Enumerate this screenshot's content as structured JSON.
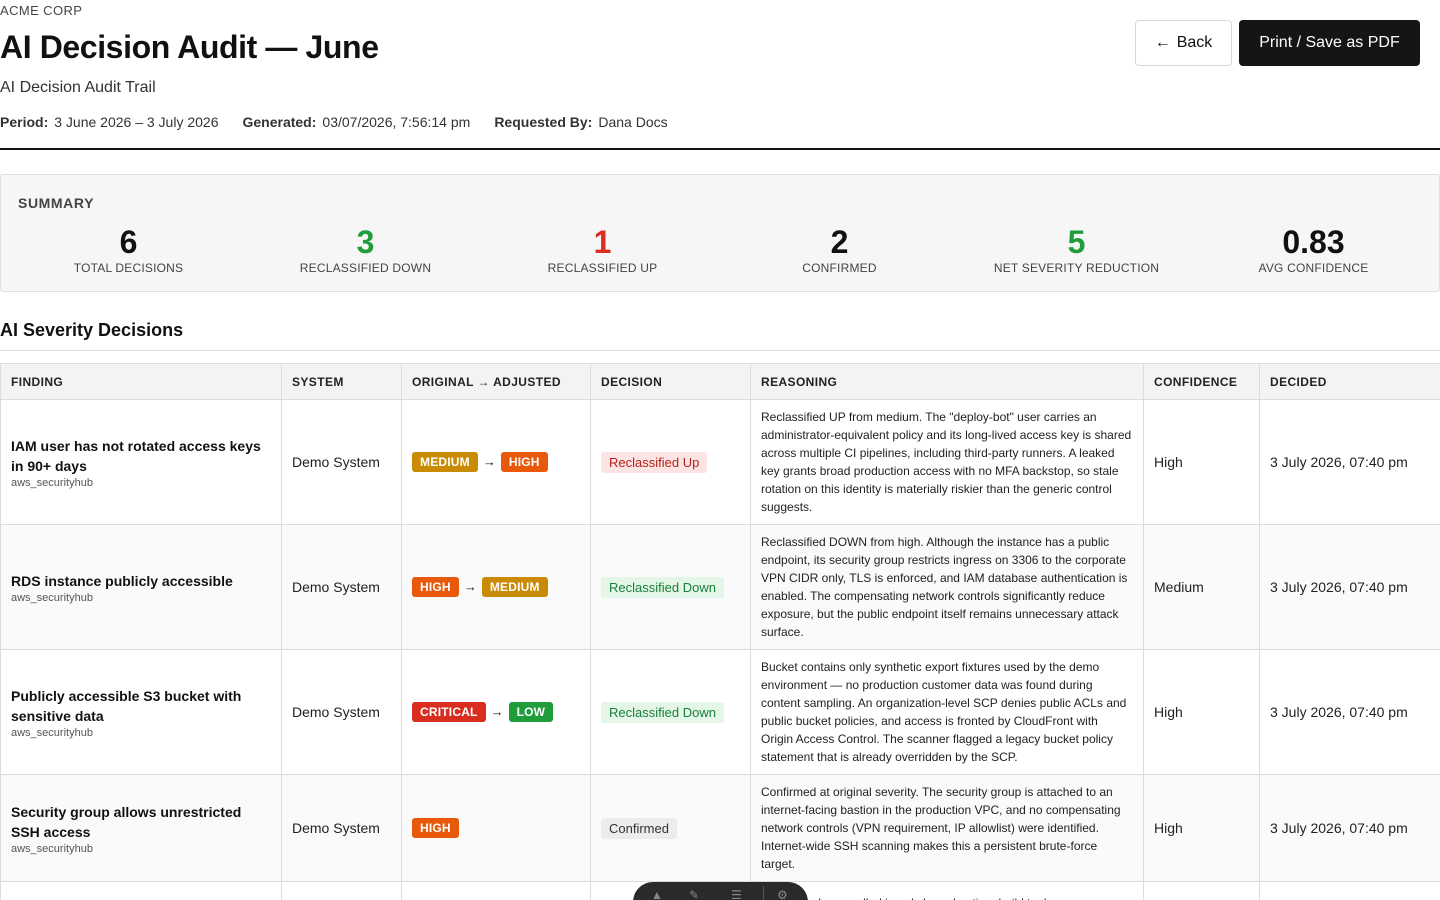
{
  "header": {
    "company": "ACME CORP",
    "title": "AI Decision Audit — June",
    "subtitle": "AI Decision Audit Trail",
    "meta": [
      {
        "key": "Period:",
        "value": "3 June 2026 – 3 July 2026"
      },
      {
        "key": "Generated:",
        "value": "03/07/2026, 7:56:14 pm"
      },
      {
        "key": "Requested By:",
        "value": "Dana Docs"
      }
    ],
    "back_label": "Back",
    "print_label": "Print / Save as PDF"
  },
  "summary": {
    "label": "SUMMARY",
    "stats": [
      {
        "value": "6",
        "label": "TOTAL DECISIONS",
        "color": "#111111"
      },
      {
        "value": "3",
        "label": "RECLASSIFIED DOWN",
        "color": "#1f9d3a"
      },
      {
        "value": "1",
        "label": "RECLASSIFIED UP",
        "color": "#d92d20"
      },
      {
        "value": "2",
        "label": "CONFIRMED",
        "color": "#111111"
      },
      {
        "value": "5",
        "label": "NET SEVERITY REDUCTION",
        "color": "#1f9d3a"
      },
      {
        "value": "0.83",
        "label": "AVG CONFIDENCE",
        "color": "#111111"
      }
    ]
  },
  "section": {
    "title": "AI Severity Decisions"
  },
  "table": {
    "columns": [
      "FINDING",
      "SYSTEM",
      "ORIGINAL → ADJUSTED",
      "DECISION",
      "REASONING",
      "CONFIDENCE",
      "DECIDED"
    ],
    "rows": [
      {
        "finding": "IAM user has not rotated access keys in 90+ days",
        "source": "aws_securityhub",
        "system": "Demo System",
        "original": "MEDIUM",
        "adjusted": "HIGH",
        "decision": "Reclassified Up",
        "reasoning": "Reclassified UP from medium. The \"deploy-bot\" user carries an administrator-equivalent policy and its long-lived access key is shared across multiple CI pipelines, including third-party runners. A leaked key grants broad production access with no MFA backstop, so stale rotation on this identity is materially riskier than the generic control suggests.",
        "confidence": "High",
        "decided": "3 July 2026, 07:40 pm"
      },
      {
        "finding": "RDS instance publicly accessible",
        "source": "aws_securityhub",
        "system": "Demo System",
        "original": "HIGH",
        "adjusted": "MEDIUM",
        "decision": "Reclassified Down",
        "reasoning": "Reclassified DOWN from high. Although the instance has a public endpoint, its security group restricts ingress on 3306 to the corporate VPN CIDR only, TLS is enforced, and IAM database authentication is enabled. The compensating network controls significantly reduce exposure, but the public endpoint itself remains unnecessary attack surface.",
        "confidence": "Medium",
        "decided": "3 July 2026, 07:40 pm"
      },
      {
        "finding": "Publicly accessible S3 bucket with sensitive data",
        "source": "aws_securityhub",
        "system": "Demo System",
        "original": "CRITICAL",
        "adjusted": "LOW",
        "decision": "Reclassified Down",
        "reasoning": "Bucket contains only synthetic export fixtures used by the demo environment — no production customer data was found during content sampling. An organization-level SCP denies public ACLs and public bucket policies, and access is fronted by CloudFront with Origin Access Control. The scanner flagged a legacy bucket policy statement that is already overridden by the SCP.",
        "confidence": "High",
        "decided": "3 July 2026, 07:40 pm"
      },
      {
        "finding": "Security group allows unrestricted SSH access",
        "source": "aws_securityhub",
        "system": "Demo System",
        "original": "HIGH",
        "adjusted": "",
        "decision": "Confirmed",
        "reasoning": "Confirmed at original severity. The security group is attached to an internet-facing bastion in the production VPC, and no compensating network controls (VPN requirement, IP allowlist) were identified. Internet-wide SSH scanning makes this a persistent brute-force target.",
        "confidence": "High",
        "decided": "3 July 2026, 07:40 pm"
      },
      {
        "finding": "",
        "source": "",
        "system": "",
        "original": "",
        "adjusted": "",
        "decision": "",
        "reasoning": "...e dependency pulled in only by a dev-time build tool",
        "confidence": "",
        "decided": ""
      }
    ]
  },
  "severity_colors": {
    "CRITICAL": "#d92d20",
    "HIGH": "#e8590c",
    "MEDIUM": "#c98a04",
    "LOW": "#1f9d3a"
  }
}
